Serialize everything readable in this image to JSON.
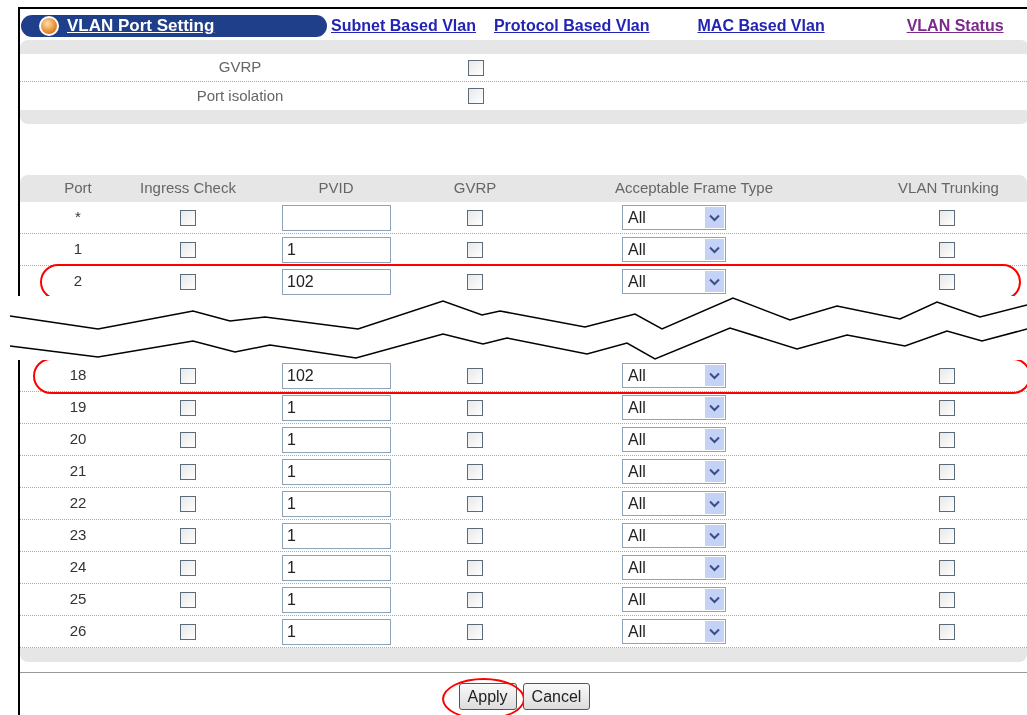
{
  "title": "VLAN Port Setting",
  "links": [
    {
      "label": "Subnet Based Vlan",
      "visited": false
    },
    {
      "label": "Protocol Based Vlan",
      "visited": false
    },
    {
      "label": "MAC Based Vlan",
      "visited": false
    },
    {
      "label": "VLAN Status",
      "visited": true
    }
  ],
  "global_settings": [
    {
      "label": "GVRP",
      "checked": false
    },
    {
      "label": "Port isolation",
      "checked": false
    }
  ],
  "table": {
    "columns": [
      "Port",
      "Ingress Check",
      "PVID",
      "GVRP",
      "Acceptable Frame Type",
      "VLAN Trunking"
    ],
    "rows": [
      {
        "kind": "port",
        "port": "*",
        "ingress_check": false,
        "gvrp": false,
        "frame_type": "All",
        "trunking": false,
        "highlighted": false
      },
      {
        "kind": "port",
        "port": "1",
        "ingress_check": false,
        "pvid": "1",
        "gvrp": false,
        "frame_type": "All",
        "trunking": false,
        "highlighted": false
      },
      {
        "kind": "port",
        "port": "2",
        "ingress_check": false,
        "pvid": "102",
        "gvrp": false,
        "frame_type": "All",
        "trunking": false,
        "highlighted": true
      },
      {
        "kind": "break"
      },
      {
        "kind": "port",
        "port": "18",
        "ingress_check": false,
        "pvid": "102",
        "gvrp": false,
        "frame_type": "All",
        "trunking": false,
        "highlighted": true
      },
      {
        "kind": "port",
        "port": "19",
        "ingress_check": false,
        "pvid": "1",
        "gvrp": false,
        "frame_type": "All",
        "trunking": false,
        "highlighted": false
      },
      {
        "kind": "port",
        "port": "20",
        "ingress_check": false,
        "pvid": "1",
        "gvrp": false,
        "frame_type": "All",
        "trunking": false,
        "highlighted": false
      },
      {
        "kind": "port",
        "port": "21",
        "ingress_check": false,
        "pvid": "1",
        "gvrp": false,
        "frame_type": "All",
        "trunking": false,
        "highlighted": false
      },
      {
        "kind": "port",
        "port": "22",
        "ingress_check": false,
        "pvid": "1",
        "gvrp": false,
        "frame_type": "All",
        "trunking": false,
        "highlighted": false
      },
      {
        "kind": "port",
        "port": "23",
        "ingress_check": false,
        "pvid": "1",
        "gvrp": false,
        "frame_type": "All",
        "trunking": false,
        "highlighted": false
      },
      {
        "kind": "port",
        "port": "24",
        "ingress_check": false,
        "pvid": "1",
        "gvrp": false,
        "frame_type": "All",
        "trunking": false,
        "highlighted": false
      },
      {
        "kind": "port",
        "port": "25",
        "ingress_check": false,
        "pvid": "1",
        "gvrp": false,
        "frame_type": "All",
        "trunking": false,
        "highlighted": false
      },
      {
        "kind": "port",
        "port": "26",
        "ingress_check": false,
        "pvid": "1",
        "gvrp": false,
        "frame_type": "All",
        "trunking": false,
        "highlighted": false
      }
    ]
  },
  "buttons": [
    {
      "label": "Apply",
      "highlighted": true
    },
    {
      "label": "Cancel",
      "highlighted": false
    }
  ]
}
